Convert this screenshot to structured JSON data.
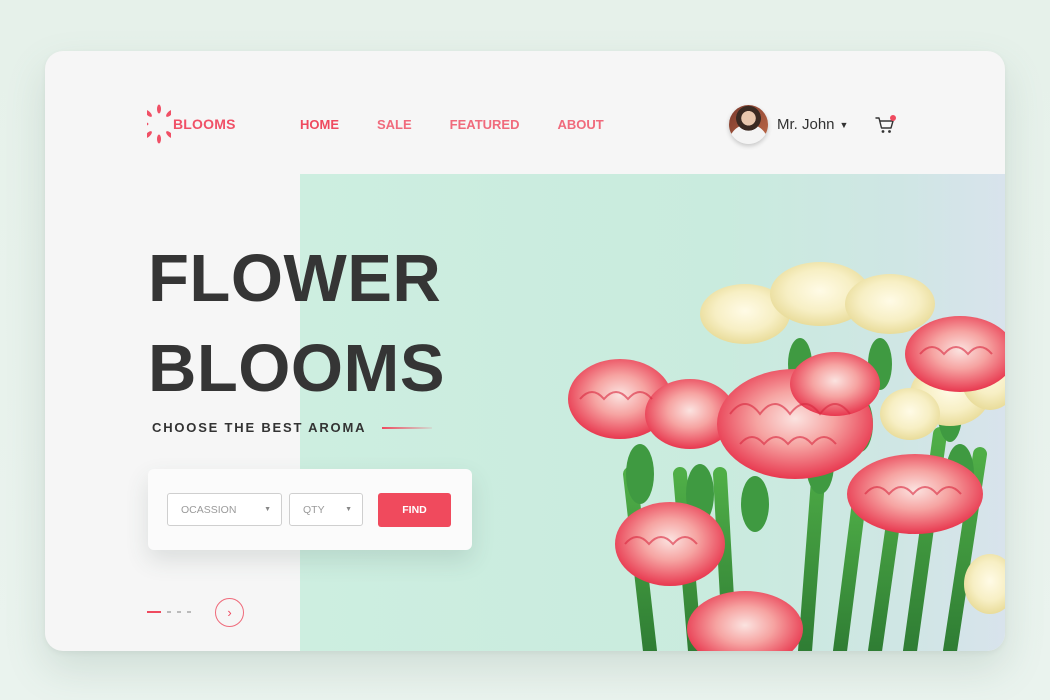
{
  "brand": {
    "name": "BLOOMS",
    "accent": "#ef4a5f"
  },
  "nav": {
    "items": [
      {
        "label": "HOME",
        "active": true
      },
      {
        "label": "SALE",
        "active": false
      },
      {
        "label": "FEATURED",
        "active": false
      },
      {
        "label": "ABOUT",
        "active": false
      }
    ]
  },
  "user": {
    "name": "Mr. John",
    "menu_icon": "chevron-down-icon",
    "cart_icon": "cart-icon",
    "cart_has_badge": true
  },
  "hero": {
    "title_line1": "FLOWER",
    "title_line2": "BLOOMS",
    "subtitle": "CHOOSE THE BEST AROMA",
    "image": "red-and-white-carnation-bouquet",
    "background_color": "#cdeee0"
  },
  "search": {
    "occasion_placeholder": "OCASSION",
    "qty_placeholder": "QTY",
    "find_label": "FIND"
  },
  "pager": {
    "dot_count": 4,
    "active_index": 0,
    "next_icon": "chevron-right-icon"
  }
}
